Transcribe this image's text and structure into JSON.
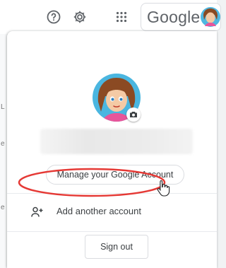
{
  "topbar": {
    "help_icon": "help-circle-icon",
    "settings_icon": "gear-icon",
    "apps_icon": "apps-grid-icon",
    "logo_text": "Google"
  },
  "left_marks": [
    "L",
    "e",
    "e"
  ],
  "account_menu": {
    "avatar_icon": "cartoon-avatar",
    "camera_icon": "camera-icon",
    "name_blurred": true,
    "manage_label": "Manage your Google Account",
    "add_account_label": "Add another account",
    "add_account_icon": "person-add-icon",
    "sign_out_label": "Sign out"
  },
  "annotation": {
    "highlight_color": "#e53935"
  },
  "colors": {
    "text": "#3c4043",
    "border": "#dadce0",
    "icon": "#5f6368"
  }
}
